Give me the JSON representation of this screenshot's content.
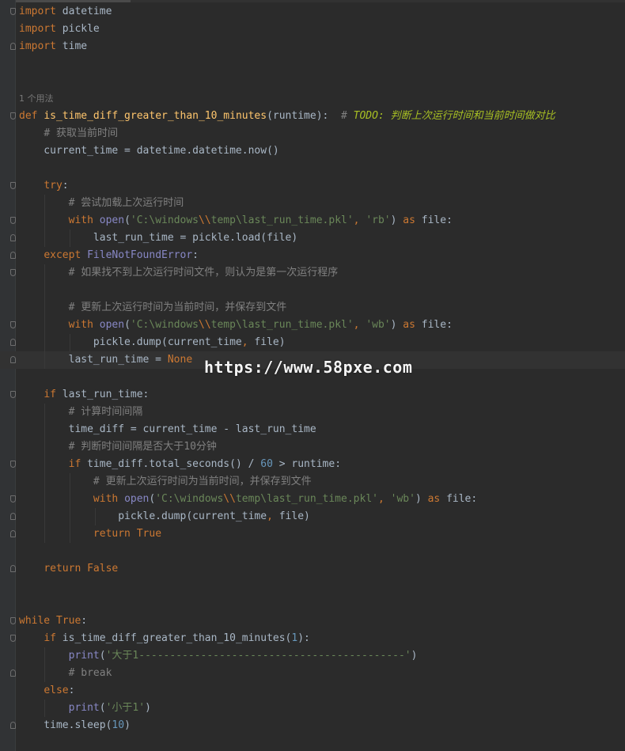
{
  "editor": {
    "lines": [
      {
        "fold": "open",
        "guides": [],
        "tokens": [
          [
            "kw",
            "import"
          ],
          [
            "plain",
            " datetime"
          ]
        ]
      },
      {
        "fold": "",
        "guides": [],
        "tokens": [
          [
            "kw",
            "import"
          ],
          [
            "plain",
            " pickle"
          ]
        ]
      },
      {
        "fold": "close",
        "guides": [],
        "tokens": [
          [
            "kw",
            "import"
          ],
          [
            "plain",
            " time"
          ]
        ]
      },
      {
        "fold": "",
        "guides": [],
        "tokens": []
      },
      {
        "fold": "",
        "guides": [],
        "tokens": []
      },
      {
        "fold": "",
        "guides": [],
        "tokens": [
          [
            "hint",
            "1 个用法"
          ]
        ]
      },
      {
        "fold": "open",
        "guides": [],
        "tokens": [
          [
            "kw",
            "def "
          ],
          [
            "fn",
            "is_time_diff_greater_than_10_minutes"
          ],
          [
            "plain",
            "(runtime):  "
          ],
          [
            "cm",
            "# "
          ],
          [
            "todo",
            "TODO: 判断上次运行时间和当前时间做对比"
          ]
        ]
      },
      {
        "fold": "",
        "guides": [],
        "tokens": [
          [
            "plain",
            "    "
          ],
          [
            "cm",
            "# 获取当前时间"
          ]
        ]
      },
      {
        "fold": "",
        "guides": [],
        "tokens": [
          [
            "plain",
            "    current_time = datetime.datetime.now()"
          ]
        ]
      },
      {
        "fold": "",
        "guides": [],
        "tokens": []
      },
      {
        "fold": "open",
        "guides": [],
        "tokens": [
          [
            "plain",
            "    "
          ],
          [
            "kw",
            "try"
          ],
          [
            "plain",
            ":"
          ]
        ]
      },
      {
        "fold": "",
        "guides": [
          1
        ],
        "tokens": [
          [
            "plain",
            "        "
          ],
          [
            "cm",
            "# 尝试加载上次运行时间"
          ]
        ]
      },
      {
        "fold": "open",
        "guides": [
          1
        ],
        "tokens": [
          [
            "plain",
            "        "
          ],
          [
            "kw",
            "with "
          ],
          [
            "bi",
            "open"
          ],
          [
            "plain",
            "("
          ],
          [
            "str",
            "'C:\\windows"
          ],
          [
            "esc",
            "\\\\"
          ],
          [
            "str",
            "temp\\last_run_time.pkl'"
          ],
          [
            "kw",
            ", "
          ],
          [
            "str",
            "'rb'"
          ],
          [
            "plain",
            ") "
          ],
          [
            "kw",
            "as "
          ],
          [
            "plain",
            "file:"
          ]
        ]
      },
      {
        "fold": "close",
        "guides": [
          1,
          2
        ],
        "tokens": [
          [
            "plain",
            "            last_run_time = pickle.load(file)"
          ]
        ]
      },
      {
        "fold": "close",
        "guides": [],
        "tokens": [
          [
            "plain",
            "    "
          ],
          [
            "kw",
            "except "
          ],
          [
            "bi",
            "FileNotFoundError"
          ],
          [
            "plain",
            ":"
          ]
        ]
      },
      {
        "fold": "open",
        "guides": [
          1
        ],
        "tokens": [
          [
            "plain",
            "        "
          ],
          [
            "cm",
            "# 如果找不到上次运行时间文件，则认为是第一次运行程序"
          ]
        ]
      },
      {
        "fold": "",
        "guides": [
          1
        ],
        "tokens": []
      },
      {
        "fold": "",
        "guides": [
          1
        ],
        "tokens": [
          [
            "plain",
            "        "
          ],
          [
            "cm",
            "# 更新上次运行时间为当前时间，并保存到文件"
          ]
        ]
      },
      {
        "fold": "open",
        "guides": [
          1
        ],
        "tokens": [
          [
            "plain",
            "        "
          ],
          [
            "kw",
            "with "
          ],
          [
            "bi",
            "open"
          ],
          [
            "plain",
            "("
          ],
          [
            "str",
            "'C:\\windows"
          ],
          [
            "esc",
            "\\\\"
          ],
          [
            "str",
            "temp\\last_run_time.pkl'"
          ],
          [
            "kw",
            ", "
          ],
          [
            "str",
            "'wb'"
          ],
          [
            "plain",
            ") "
          ],
          [
            "kw",
            "as "
          ],
          [
            "plain",
            "file:"
          ]
        ]
      },
      {
        "fold": "close",
        "guides": [
          1,
          2
        ],
        "tokens": [
          [
            "plain",
            "            pickle.dump(current_time"
          ],
          [
            "kw",
            ", "
          ],
          [
            "plain",
            "file)"
          ]
        ]
      },
      {
        "fold": "close",
        "guides": [
          1
        ],
        "hl": true,
        "tokens": [
          [
            "plain",
            "        last_run_time = "
          ],
          [
            "kw",
            "None"
          ]
        ]
      },
      {
        "fold": "",
        "guides": [],
        "tokens": []
      },
      {
        "fold": "open",
        "guides": [],
        "tokens": [
          [
            "plain",
            "    "
          ],
          [
            "kw",
            "if "
          ],
          [
            "plain",
            "last_run_time:"
          ]
        ]
      },
      {
        "fold": "",
        "guides": [
          1
        ],
        "tokens": [
          [
            "plain",
            "        "
          ],
          [
            "cm",
            "# 计算时间间隔"
          ]
        ]
      },
      {
        "fold": "",
        "guides": [
          1
        ],
        "tokens": [
          [
            "plain",
            "        time_diff = current_time - last_run_time"
          ]
        ]
      },
      {
        "fold": "",
        "guides": [
          1
        ],
        "tokens": [
          [
            "plain",
            "        "
          ],
          [
            "cm",
            "# 判断时间间隔是否大于10分钟"
          ]
        ]
      },
      {
        "fold": "open",
        "guides": [
          1
        ],
        "tokens": [
          [
            "plain",
            "        "
          ],
          [
            "kw",
            "if "
          ],
          [
            "plain",
            "time_diff.total_seconds() / "
          ],
          [
            "num",
            "60"
          ],
          [
            "plain",
            " > runtime:"
          ]
        ]
      },
      {
        "fold": "",
        "guides": [
          1,
          2
        ],
        "tokens": [
          [
            "plain",
            "            "
          ],
          [
            "cm",
            "# 更新上次运行时间为当前时间，并保存到文件"
          ]
        ]
      },
      {
        "fold": "open",
        "guides": [
          1,
          2
        ],
        "tokens": [
          [
            "plain",
            "            "
          ],
          [
            "kw",
            "with "
          ],
          [
            "bi",
            "open"
          ],
          [
            "plain",
            "("
          ],
          [
            "str",
            "'C:\\windows"
          ],
          [
            "esc",
            "\\\\"
          ],
          [
            "str",
            "temp\\last_run_time.pkl'"
          ],
          [
            "kw",
            ", "
          ],
          [
            "str",
            "'wb'"
          ],
          [
            "plain",
            ") "
          ],
          [
            "kw",
            "as "
          ],
          [
            "plain",
            "file:"
          ]
        ]
      },
      {
        "fold": "close",
        "guides": [
          1,
          2,
          3
        ],
        "tokens": [
          [
            "plain",
            "                pickle.dump(current_time"
          ],
          [
            "kw",
            ", "
          ],
          [
            "plain",
            "file)"
          ]
        ]
      },
      {
        "fold": "close",
        "guides": [
          1,
          2
        ],
        "tokens": [
          [
            "plain",
            "            "
          ],
          [
            "kw",
            "return True"
          ]
        ]
      },
      {
        "fold": "",
        "guides": [],
        "tokens": []
      },
      {
        "fold": "close",
        "guides": [],
        "tokens": [
          [
            "plain",
            "    "
          ],
          [
            "kw",
            "return False"
          ]
        ]
      },
      {
        "fold": "",
        "guides": [],
        "tokens": []
      },
      {
        "fold": "",
        "guides": [],
        "tokens": []
      },
      {
        "fold": "open",
        "guides": [],
        "tokens": [
          [
            "kw",
            "while True"
          ],
          [
            "plain",
            ":"
          ]
        ]
      },
      {
        "fold": "open",
        "guides": [],
        "tokens": [
          [
            "plain",
            "    "
          ],
          [
            "kw",
            "if "
          ],
          [
            "plain",
            "is_time_diff_greater_than_10_minutes("
          ],
          [
            "num",
            "1"
          ],
          [
            "plain",
            "):"
          ]
        ]
      },
      {
        "fold": "",
        "guides": [
          1
        ],
        "tokens": [
          [
            "plain",
            "        "
          ],
          [
            "bi",
            "print"
          ],
          [
            "plain",
            "("
          ],
          [
            "str",
            "'大于1-------------------------------------------'"
          ],
          [
            "plain",
            ")"
          ]
        ]
      },
      {
        "fold": "close",
        "guides": [
          1
        ],
        "tokens": [
          [
            "plain",
            "        "
          ],
          [
            "cm",
            "# break"
          ]
        ]
      },
      {
        "fold": "",
        "guides": [],
        "tokens": [
          [
            "plain",
            "    "
          ],
          [
            "kw",
            "else"
          ],
          [
            "plain",
            ":"
          ]
        ]
      },
      {
        "fold": "",
        "guides": [
          1
        ],
        "tokens": [
          [
            "plain",
            "        "
          ],
          [
            "bi",
            "print"
          ],
          [
            "plain",
            "("
          ],
          [
            "str",
            "'小于1'"
          ],
          [
            "plain",
            ")"
          ]
        ]
      },
      {
        "fold": "close",
        "guides": [],
        "tokens": [
          [
            "plain",
            "    time.sleep("
          ],
          [
            "num",
            "10"
          ],
          [
            "plain",
            ")"
          ]
        ]
      }
    ]
  },
  "watermark": {
    "text": "https://www.58pxe.com"
  }
}
